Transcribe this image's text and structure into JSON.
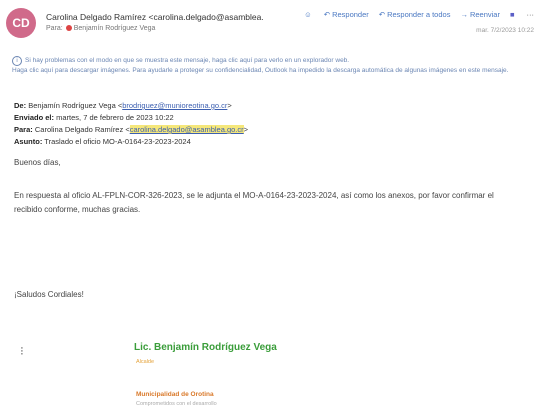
{
  "header": {
    "avatar_initials": "CD",
    "avatar_color": "#d06a8a",
    "from": "Carolina Delgado Ramírez <carolina.delgado@asamblea.",
    "to_prefix": "Para:",
    "to": "Benjamín Rodríguez Vega",
    "actions": [
      {
        "icon": "emoji-icon",
        "glyph": "☺",
        "label": ""
      },
      {
        "icon": "reply-icon",
        "glyph": "↶",
        "label": "Responder"
      },
      {
        "icon": "reply-all-icon",
        "glyph": "↶",
        "label": "Responder a todos"
      },
      {
        "icon": "forward-icon",
        "glyph": "→",
        "label": "Reenviar"
      },
      {
        "icon": "teams-icon",
        "glyph": "■",
        "label": ""
      },
      {
        "icon": "more-icon",
        "glyph": "···",
        "label": ""
      }
    ],
    "date": "mar. 7/2/2023 10:22"
  },
  "notice": {
    "line1": "Si hay problemas con el modo en que se muestra este mensaje, haga clic aquí para verlo en un explorador web.",
    "line2": "Haga clic aquí para descargar imágenes. Para ayudarle a proteger su confidencialidad, Outlook ha impedido la descarga automática de algunas imágenes en este mensaje."
  },
  "meta": {
    "de_label": "De:",
    "de_value": "Benjamín Rodríguez Vega <",
    "de_email": "brodriguez@munioreotina.go.cr",
    "de_close": ">",
    "enviado_label": "Enviado el:",
    "enviado_value": "martes, 7 de febrero de 2023 10:22",
    "para_label": "Para:",
    "para_value": "Carolina Delgado Ramírez <",
    "para_email": "carolina.delgado@asamblea.go.cr",
    "para_close": ">",
    "asunto_label": "Asunto:",
    "asunto_value": "Traslado el oficio MO-A-0164-23-2023-2024"
  },
  "body": {
    "greeting": "Buenos días,",
    "para1_line1": "En respuesta al oficio AL-FPLN-COR-326-2023, se le adjunta el MO-A-0164-23-2023-2024, así como los anexos, por favor confirmar el",
    "para1_line2": "recibido conforme, muchas gracias.",
    "closing": "¡Saludos Cordiales!"
  },
  "signature": {
    "logo_glyph": "⁝",
    "name": "Lic. Benjamín Rodríguez Vega",
    "role": "Alcalde",
    "org": "Municipalidad de Orotina",
    "org_sub": "Comprometidos con el desarrollo"
  }
}
